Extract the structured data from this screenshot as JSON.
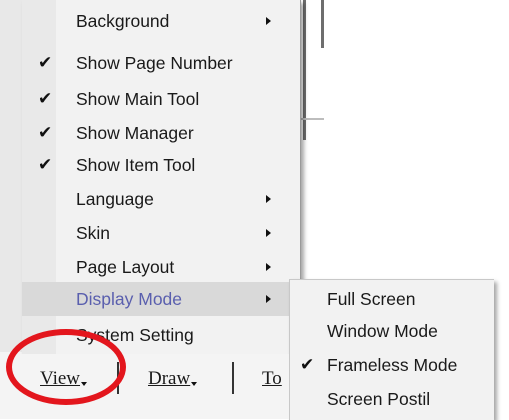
{
  "menu": {
    "items": [
      {
        "label": "Background",
        "checked": false,
        "submenu": true
      },
      {
        "label": "Show Page Number",
        "checked": true,
        "submenu": false
      },
      {
        "label": "Show Main Tool",
        "checked": true,
        "submenu": false
      },
      {
        "label": "Show Manager",
        "checked": true,
        "submenu": false
      },
      {
        "label": "Show Item Tool",
        "checked": true,
        "submenu": false
      },
      {
        "label": "Language",
        "checked": false,
        "submenu": true
      },
      {
        "label": "Skin",
        "checked": false,
        "submenu": true
      },
      {
        "label": "Page Layout",
        "checked": false,
        "submenu": true
      },
      {
        "label": "Display Mode",
        "checked": false,
        "submenu": true,
        "highlighted": true
      },
      {
        "label": "System Setting",
        "checked": false,
        "submenu": false
      }
    ]
  },
  "submenu": {
    "items": [
      {
        "label": "Full Screen",
        "checked": false
      },
      {
        "label": "Window Mode",
        "checked": false
      },
      {
        "label": "Frameless Mode",
        "checked": true
      },
      {
        "label": "Screen Postil",
        "checked": false
      }
    ]
  },
  "toolbar": {
    "view_label": "View",
    "draw_label": "Draw",
    "tools_label": "To"
  },
  "check_glyph": "✔",
  "colors": {
    "highlight_text": "#5a5fae",
    "annotation_circle": "#e3161d"
  }
}
